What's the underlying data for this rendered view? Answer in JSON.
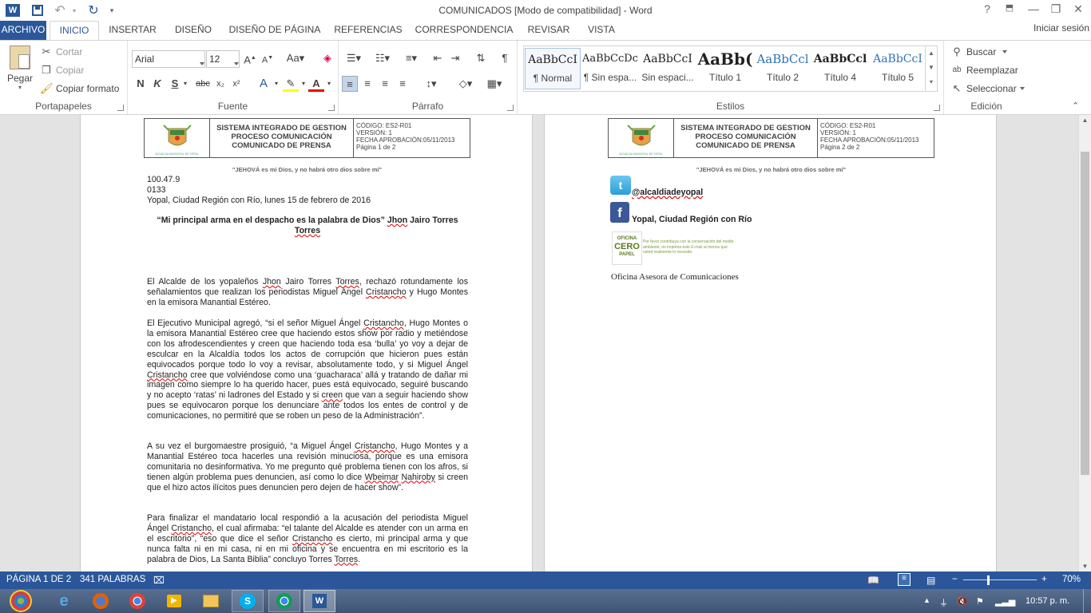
{
  "window": {
    "title": "COMUNICADOS [Modo de compatibilidad] - Word",
    "help": "?",
    "minimize": "—",
    "restore": "❐",
    "close": "✕"
  },
  "qat": {
    "word_icon": "W",
    "save_icon": "save-icon",
    "undo_icon": "↶",
    "redo_icon": "↻"
  },
  "tabs": [
    {
      "label": "ARCHIVO"
    },
    {
      "label": "INICIO"
    },
    {
      "label": "INSERTAR"
    },
    {
      "label": "DISEÑO"
    },
    {
      "label": "DISEÑO DE PÁGINA"
    },
    {
      "label": "REFERENCIAS"
    },
    {
      "label": "CORRESPONDENCIA"
    },
    {
      "label": "REVISAR"
    },
    {
      "label": "VISTA"
    }
  ],
  "signin": "Iniciar sesión",
  "ribbon": {
    "clipboard": {
      "label": "Portapapeles",
      "paste": "Pegar",
      "cut": "Cortar",
      "copy": "Copiar",
      "format_painter": "Copiar formato"
    },
    "font": {
      "label": "Fuente",
      "family": "Arial",
      "size": "12"
    },
    "paragraph": {
      "label": "Párrafo"
    },
    "styles": {
      "label": "Estilos",
      "items": [
        {
          "preview": "AaBbCcI",
          "name": "¶ Normal"
        },
        {
          "preview": "AaBbCcDc",
          "name": "¶ Sin espa..."
        },
        {
          "preview": "AaBbCcI",
          "name": "Sin espaci..."
        },
        {
          "preview": "AaBb(",
          "name": "Título 1"
        },
        {
          "preview": "AaBbCcl",
          "name": "Título 2"
        },
        {
          "preview": "AaBbCcl",
          "name": "Título 4"
        },
        {
          "preview": "AaBbCcI",
          "name": "Título 5"
        }
      ]
    },
    "editing": {
      "label": "Edición",
      "find": "Buscar",
      "replace": "Reemplazar",
      "select": "Seleccionar"
    }
  },
  "header": {
    "logo_caption": "ALCALDIA MUNICIPAL DE YOPAL",
    "line1": "SISTEMA INTEGRADO DE GESTION",
    "line2": "PROCESO COMUNICACIÓN",
    "line3": "COMUNICADO DE PRENSA",
    "code": "CÓDIGO: ES2-R01",
    "version": "VERSIÓN: 1",
    "date": "FECHA APROBACIÓN:05/11/2013",
    "page1": "Página 1 de 2",
    "page2": "Página 2 de 2",
    "motto": "\"JEHOVÁ es mi Dios, y no habrá otro dios sobre mí\""
  },
  "page1": {
    "line_freq": "100.47.9",
    "line_num": "0133",
    "dateline": "Yopal, Ciudad Región con Río, lunes 15 de febrero de 2016",
    "heading_a": "“Mi principal arma en el despacho es la palabra de Dios” ",
    "heading_b": "Jhon",
    "heading_c": " Jairo Torres",
    "heading_d": "Torres",
    "p1a": "El Alcalde de los yopaleños ",
    "p1b": "Jhon",
    "p1c": " Jairo Torres ",
    "p1d": "Torres",
    "p1e": ", rechazó rotundamente los señalamientos que realizan los periodistas Miguel Ángel ",
    "p1f": "Cristancho",
    "p1g": " y Hugo Montes en la emisora Manantial Estéreo.",
    "p2a": "El Ejecutivo Municipal agregó, “si el señor Miguel Ángel ",
    "p2b": "Cristancho",
    "p2c": ", Hugo Montes o la emisora Manantial Estéreo cree que haciendo estos show por radio y metiéndose con los afrodescendientes y creen que haciendo toda esa ‘bulla’ yo voy a dejar de esculcar en la Alcaldía todos los actos de corrupción que hicieron pues están equivocados porque todo lo voy a revisar, absolutamente todo, y si Miguel Ángel ",
    "p2d": "Cristancho",
    "p2e": " cree que volviéndose como una ‘guacharaca’ allá y tratando de dañar mi imagen como siempre lo ha querido hacer, pues está equivocado, seguiré buscando y no acepto ‘ratas’ ni ladrones del Estado y si ",
    "p2f": "creen",
    "p2g": " que van a seguir haciendo show pues se equivocaron porque los denunciare ante todos los entes de control y de comunicaciones, no permitiré que se roben un peso de la Administración”.",
    "p3a": "A su vez el burgomaestre prosiguió, “a Miguel Ángel ",
    "p3b": "Cristancho",
    "p3c": ", Hugo Montes y a Manantial Estéreo toca hacerles una revisión minuciosa, porque es una emisora comunitaria no desinformativa. Yo me pregunto qué problema tienen con los afros, si tienen algún problema pues denuncien, así como lo dice ",
    "p3d": "Wbeimar",
    "p3e": " ",
    "p3f": "Nahiroby",
    "p3g": " si creen que el hizo actos ilícitos pues denuncien pero dejen de hacer show”.",
    "p4a": "Para finalizar el mandatario local respondió a la acusación del periodista Miguel Ángel ",
    "p4b": "Cristancho",
    "p4c": ", el cual afirmaba: “el talante del Alcalde es atender con un arma en el escritorio”, “eso que dice el señor ",
    "p4d": "Cristancho",
    "p4e": " es cierto, mi principal arma y que nunca falta ni en mi casa, ni en mi oficina y se encuentra en mi escritorio es la palabra de Dios, La Santa Biblia” concluyo Torres ",
    "p4f": "Torres",
    "p4g": "."
  },
  "page2": {
    "twitter": "@alcaldiadeyopal",
    "facebook": "Yopal, Ciudad Región con Río",
    "cero_1": "OFICINA",
    "cero_2": "CERO",
    "cero_3": "PAPEL",
    "cero_note": "Por favor contribuya con la conservación del medio ambiente, no imprima este E-mail al menos que usted realmente lo necesite.",
    "signature": "Oficina Asesora de Comunicaciones"
  },
  "status": {
    "page": "PÁGINA 1 DE 2",
    "words": "341 PALABRAS",
    "zoom": "70%"
  },
  "taskbar": {
    "time": "10:57 p. m."
  },
  "colors": {
    "accent": "#2b579a",
    "doc_bg": "#e3e3e3",
    "spell": "#d00"
  }
}
